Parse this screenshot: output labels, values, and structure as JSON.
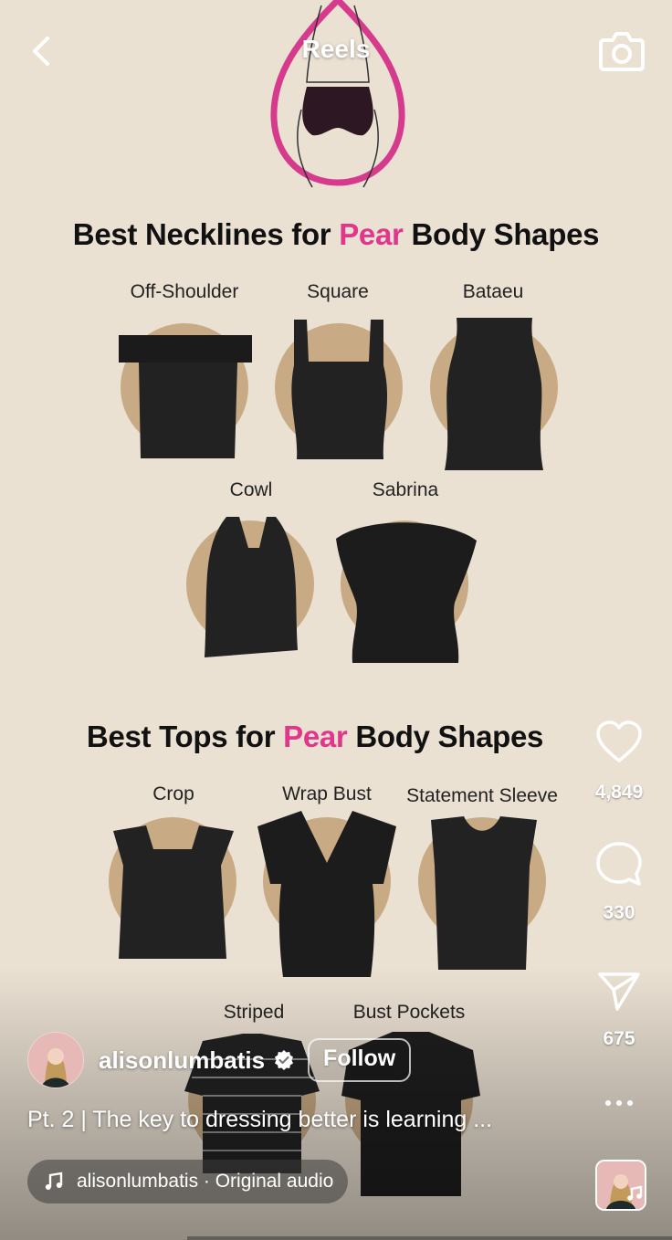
{
  "header": {
    "title": "Reels",
    "back_icon": "chevron-left-icon",
    "camera_icon": "camera-icon"
  },
  "post_image": {
    "necklines_heading": {
      "pre": "Best Necklines for ",
      "accent": "Pear",
      "post": " Body Shapes"
    },
    "necklines": [
      "Off-Shoulder",
      "Square",
      "Bataeu",
      "Cowl",
      "Sabrina"
    ],
    "tops_heading": {
      "pre": "Best Tops for ",
      "accent": "Pear",
      "post": " Body Shapes"
    },
    "tops": [
      "Crop",
      "Wrap Bust",
      "Statement Sleeve",
      "Striped",
      "Bust Pockets"
    ],
    "accent_color": "#e0368c"
  },
  "actions": {
    "likes": "4,849",
    "comments": "330",
    "shares": "675",
    "icons": [
      "heart-icon",
      "comment-icon",
      "share-icon",
      "more-icon"
    ]
  },
  "author": {
    "username": "alisonlumbatis",
    "verified": true,
    "follow_label": "Follow"
  },
  "caption": "Pt. 2 |  The key to dressing better is learning ...",
  "audio": {
    "label": "alisonlumbatis · Original audio"
  }
}
